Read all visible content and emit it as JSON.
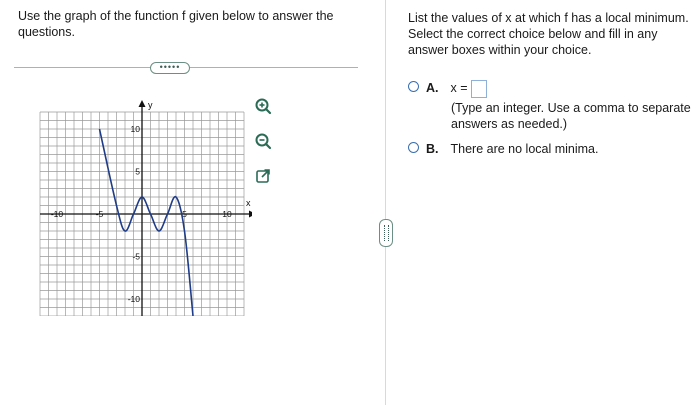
{
  "left": {
    "question": "Use the graph of the function f given below to answer the questions.",
    "more_label": "•••••"
  },
  "graph": {
    "x_axis_label": "x",
    "y_axis_label": "y",
    "tick_labels": {
      "x_neg10": "-10",
      "x_neg5": "-5",
      "x_pos5": "5",
      "x_pos10": "10",
      "y_pos10": "10",
      "y_pos5": "5",
      "y_neg5": "-5",
      "y_neg10": "-10"
    },
    "xlim": [
      -12,
      12
    ],
    "ylim": [
      -12,
      12
    ],
    "curve_points": [
      [
        -5,
        10
      ],
      [
        -3,
        1
      ],
      [
        -2,
        -2
      ],
      [
        -1,
        0
      ],
      [
        0,
        2
      ],
      [
        1,
        0
      ],
      [
        2,
        -2
      ],
      [
        3,
        0
      ],
      [
        4,
        2
      ],
      [
        5,
        -2
      ],
      [
        6,
        -12
      ]
    ]
  },
  "tools": {
    "zoom_in": "zoom-in",
    "zoom_out": "zoom-out",
    "popout": "open-new-window"
  },
  "right": {
    "instructions": "List the values of x at which f has a local minimum. Select the correct choice below and fill in any answer boxes within your choice.",
    "choice_a_letter": "A.",
    "choice_a_prefix": "x =",
    "choice_a_hint": "(Type an integer. Use a comma to separate answers as needed.)",
    "choice_b_letter": "B.",
    "choice_b_text": "There are no local minima."
  },
  "colors": {
    "accent": "#3a6fb0",
    "curve": "#1f3c88",
    "grid": "#9a9a9a"
  }
}
